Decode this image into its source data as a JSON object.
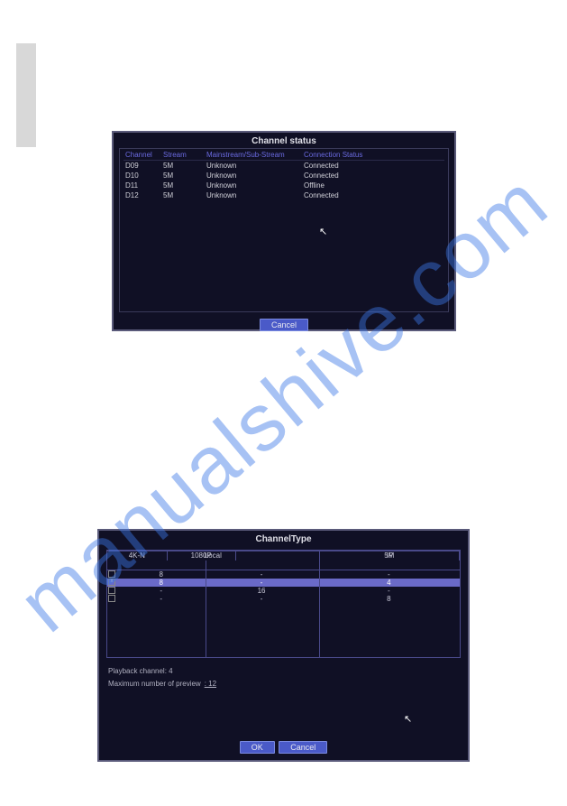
{
  "watermark": "manualshive.com",
  "dialog1": {
    "title": "Channel status",
    "headers": {
      "channel": "Channel",
      "stream": "Stream",
      "mainsub": "Mainstream/Sub-Stream",
      "conn": "Connection Status"
    },
    "rows": [
      {
        "ch": "D09",
        "st": "5M",
        "ms": "Unknown",
        "cs": "Connected"
      },
      {
        "ch": "D10",
        "st": "5M",
        "ms": "Unknown",
        "cs": "Connected"
      },
      {
        "ch": "D11",
        "st": "5M",
        "ms": "Unknown",
        "cs": "Offline"
      },
      {
        "ch": "D12",
        "st": "5M",
        "ms": "Unknown",
        "cs": "Connected"
      }
    ],
    "cancel": "Cancel"
  },
  "dialog2": {
    "title": "ChannelType",
    "local": "Local",
    "ip": "IP",
    "col_4k": "4K-N",
    "col_1080": "1080P",
    "col_5m": "5M",
    "rows": [
      {
        "v4k": "8",
        "v1080": "-",
        "v5m": "-",
        "hl": false,
        "ck": false
      },
      {
        "v4k": "8",
        "v1080": "-",
        "v5m": "4",
        "hl": true,
        "ck": true
      },
      {
        "v4k": "-",
        "v1080": "16",
        "v5m": "-",
        "hl": false,
        "ck": false
      },
      {
        "v4k": "-",
        "v1080": "-",
        "v5m": "8",
        "hl": false,
        "ck": false
      }
    ],
    "playback_label": "Playback channel: ",
    "playback_val": "4",
    "preview_label": "Maximum number of preview",
    "preview_val": ": 12",
    "ok": "OK",
    "cancel": "Cancel"
  }
}
